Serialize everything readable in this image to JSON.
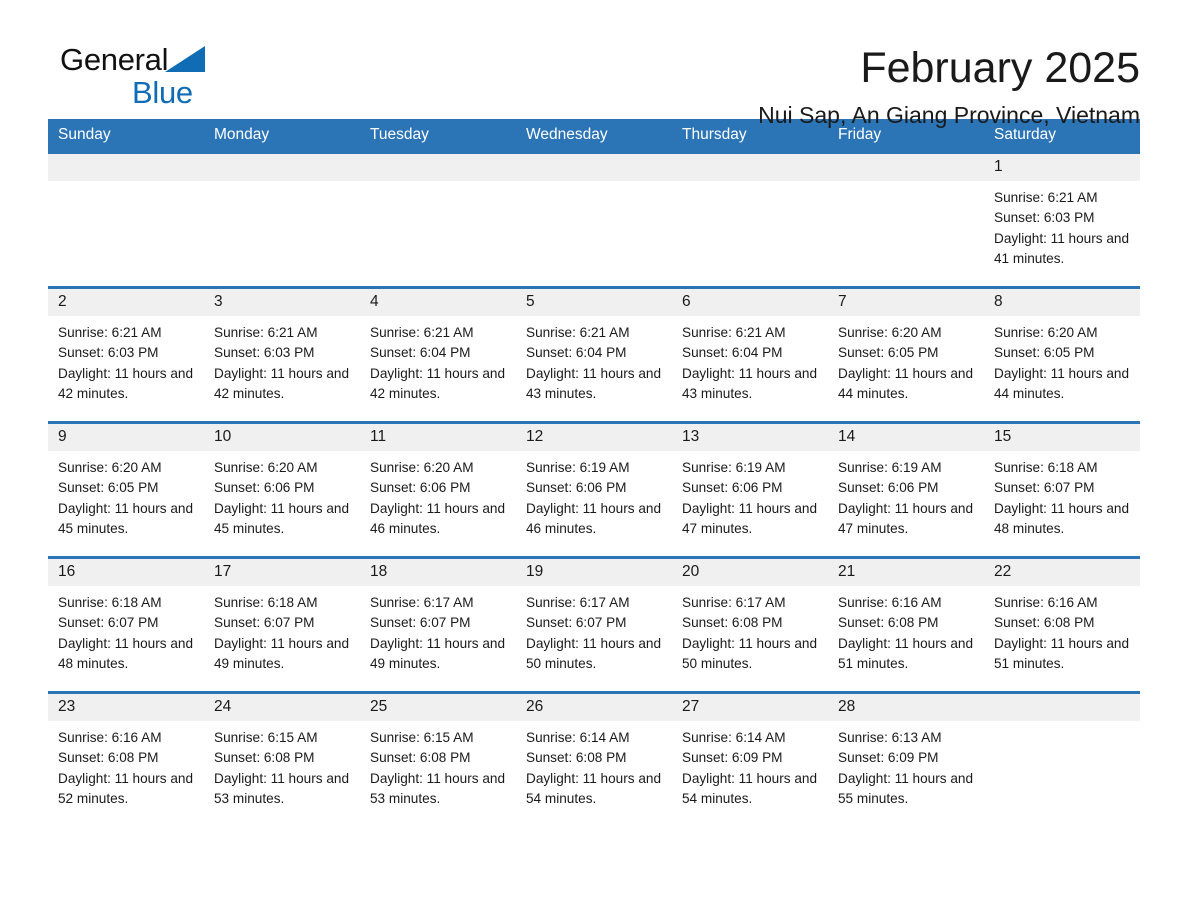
{
  "brand": {
    "name_part1": "General",
    "name_part2": "Blue"
  },
  "header": {
    "month_title": "February 2025",
    "location": "Nui Sap, An Giang Province, Vietnam"
  },
  "colors": {
    "header_blue": "#2b74b6",
    "brand_blue": "#0f6cb5",
    "daynum_band": "#f0f0f0"
  },
  "weekday_headers": [
    "Sunday",
    "Monday",
    "Tuesday",
    "Wednesday",
    "Thursday",
    "Friday",
    "Saturday"
  ],
  "weeks": [
    [
      {
        "day": "",
        "sunrise": "",
        "sunset": "",
        "daylight": ""
      },
      {
        "day": "",
        "sunrise": "",
        "sunset": "",
        "daylight": ""
      },
      {
        "day": "",
        "sunrise": "",
        "sunset": "",
        "daylight": ""
      },
      {
        "day": "",
        "sunrise": "",
        "sunset": "",
        "daylight": ""
      },
      {
        "day": "",
        "sunrise": "",
        "sunset": "",
        "daylight": ""
      },
      {
        "day": "",
        "sunrise": "",
        "sunset": "",
        "daylight": ""
      },
      {
        "day": "1",
        "sunrise": "Sunrise: 6:21 AM",
        "sunset": "Sunset: 6:03 PM",
        "daylight": "Daylight: 11 hours and 41 minutes."
      }
    ],
    [
      {
        "day": "2",
        "sunrise": "Sunrise: 6:21 AM",
        "sunset": "Sunset: 6:03 PM",
        "daylight": "Daylight: 11 hours and 42 minutes."
      },
      {
        "day": "3",
        "sunrise": "Sunrise: 6:21 AM",
        "sunset": "Sunset: 6:03 PM",
        "daylight": "Daylight: 11 hours and 42 minutes."
      },
      {
        "day": "4",
        "sunrise": "Sunrise: 6:21 AM",
        "sunset": "Sunset: 6:04 PM",
        "daylight": "Daylight: 11 hours and 42 minutes."
      },
      {
        "day": "5",
        "sunrise": "Sunrise: 6:21 AM",
        "sunset": "Sunset: 6:04 PM",
        "daylight": "Daylight: 11 hours and 43 minutes."
      },
      {
        "day": "6",
        "sunrise": "Sunrise: 6:21 AM",
        "sunset": "Sunset: 6:04 PM",
        "daylight": "Daylight: 11 hours and 43 minutes."
      },
      {
        "day": "7",
        "sunrise": "Sunrise: 6:20 AM",
        "sunset": "Sunset: 6:05 PM",
        "daylight": "Daylight: 11 hours and 44 minutes."
      },
      {
        "day": "8",
        "sunrise": "Sunrise: 6:20 AM",
        "sunset": "Sunset: 6:05 PM",
        "daylight": "Daylight: 11 hours and 44 minutes."
      }
    ],
    [
      {
        "day": "9",
        "sunrise": "Sunrise: 6:20 AM",
        "sunset": "Sunset: 6:05 PM",
        "daylight": "Daylight: 11 hours and 45 minutes."
      },
      {
        "day": "10",
        "sunrise": "Sunrise: 6:20 AM",
        "sunset": "Sunset: 6:06 PM",
        "daylight": "Daylight: 11 hours and 45 minutes."
      },
      {
        "day": "11",
        "sunrise": "Sunrise: 6:20 AM",
        "sunset": "Sunset: 6:06 PM",
        "daylight": "Daylight: 11 hours and 46 minutes."
      },
      {
        "day": "12",
        "sunrise": "Sunrise: 6:19 AM",
        "sunset": "Sunset: 6:06 PM",
        "daylight": "Daylight: 11 hours and 46 minutes."
      },
      {
        "day": "13",
        "sunrise": "Sunrise: 6:19 AM",
        "sunset": "Sunset: 6:06 PM",
        "daylight": "Daylight: 11 hours and 47 minutes."
      },
      {
        "day": "14",
        "sunrise": "Sunrise: 6:19 AM",
        "sunset": "Sunset: 6:06 PM",
        "daylight": "Daylight: 11 hours and 47 minutes."
      },
      {
        "day": "15",
        "sunrise": "Sunrise: 6:18 AM",
        "sunset": "Sunset: 6:07 PM",
        "daylight": "Daylight: 11 hours and 48 minutes."
      }
    ],
    [
      {
        "day": "16",
        "sunrise": "Sunrise: 6:18 AM",
        "sunset": "Sunset: 6:07 PM",
        "daylight": "Daylight: 11 hours and 48 minutes."
      },
      {
        "day": "17",
        "sunrise": "Sunrise: 6:18 AM",
        "sunset": "Sunset: 6:07 PM",
        "daylight": "Daylight: 11 hours and 49 minutes."
      },
      {
        "day": "18",
        "sunrise": "Sunrise: 6:17 AM",
        "sunset": "Sunset: 6:07 PM",
        "daylight": "Daylight: 11 hours and 49 minutes."
      },
      {
        "day": "19",
        "sunrise": "Sunrise: 6:17 AM",
        "sunset": "Sunset: 6:07 PM",
        "daylight": "Daylight: 11 hours and 50 minutes."
      },
      {
        "day": "20",
        "sunrise": "Sunrise: 6:17 AM",
        "sunset": "Sunset: 6:08 PM",
        "daylight": "Daylight: 11 hours and 50 minutes."
      },
      {
        "day": "21",
        "sunrise": "Sunrise: 6:16 AM",
        "sunset": "Sunset: 6:08 PM",
        "daylight": "Daylight: 11 hours and 51 minutes."
      },
      {
        "day": "22",
        "sunrise": "Sunrise: 6:16 AM",
        "sunset": "Sunset: 6:08 PM",
        "daylight": "Daylight: 11 hours and 51 minutes."
      }
    ],
    [
      {
        "day": "23",
        "sunrise": "Sunrise: 6:16 AM",
        "sunset": "Sunset: 6:08 PM",
        "daylight": "Daylight: 11 hours and 52 minutes."
      },
      {
        "day": "24",
        "sunrise": "Sunrise: 6:15 AM",
        "sunset": "Sunset: 6:08 PM",
        "daylight": "Daylight: 11 hours and 53 minutes."
      },
      {
        "day": "25",
        "sunrise": "Sunrise: 6:15 AM",
        "sunset": "Sunset: 6:08 PM",
        "daylight": "Daylight: 11 hours and 53 minutes."
      },
      {
        "day": "26",
        "sunrise": "Sunrise: 6:14 AM",
        "sunset": "Sunset: 6:08 PM",
        "daylight": "Daylight: 11 hours and 54 minutes."
      },
      {
        "day": "27",
        "sunrise": "Sunrise: 6:14 AM",
        "sunset": "Sunset: 6:09 PM",
        "daylight": "Daylight: 11 hours and 54 minutes."
      },
      {
        "day": "28",
        "sunrise": "Sunrise: 6:13 AM",
        "sunset": "Sunset: 6:09 PM",
        "daylight": "Daylight: 11 hours and 55 minutes."
      },
      {
        "day": "",
        "sunrise": "",
        "sunset": "",
        "daylight": ""
      }
    ]
  ]
}
